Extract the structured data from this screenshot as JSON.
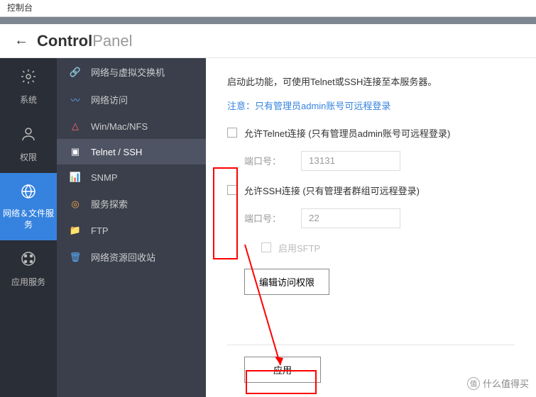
{
  "titlebar": "控制台",
  "brand": {
    "bold": "Control",
    "light": "Panel"
  },
  "categories": [
    {
      "label": "系统"
    },
    {
      "label": "权限"
    },
    {
      "label": "网络＆文件服务"
    },
    {
      "label": "应用服务"
    }
  ],
  "submenu": [
    {
      "label": "网络与虚拟交换机"
    },
    {
      "label": "网络访问"
    },
    {
      "label": "Win/Mac/NFS"
    },
    {
      "label": "Telnet / SSH"
    },
    {
      "label": "SNMP"
    },
    {
      "label": "服务探索"
    },
    {
      "label": "FTP"
    },
    {
      "label": "网络资源回收站"
    }
  ],
  "content": {
    "desc": "启动此功能，可使用Telnet或SSH连接至本服务器。",
    "notice": "注意：只有管理员admin账号可远程登录",
    "telnet_label": "允许Telnet连接 (只有管理员admin账号可远程登录)",
    "telnet_port_label": "端口号：",
    "telnet_port_value": "13131",
    "ssh_label": "允许SSH连接 (只有管理者群组可远程登录)",
    "ssh_port_label": "端口号：",
    "ssh_port_value": "22",
    "sftp_label": "启用SFTP",
    "edit_btn": "编辑访问权限",
    "apply_btn": "应用"
  },
  "watermark": {
    "badge": "值",
    "text": "什么值得买"
  }
}
